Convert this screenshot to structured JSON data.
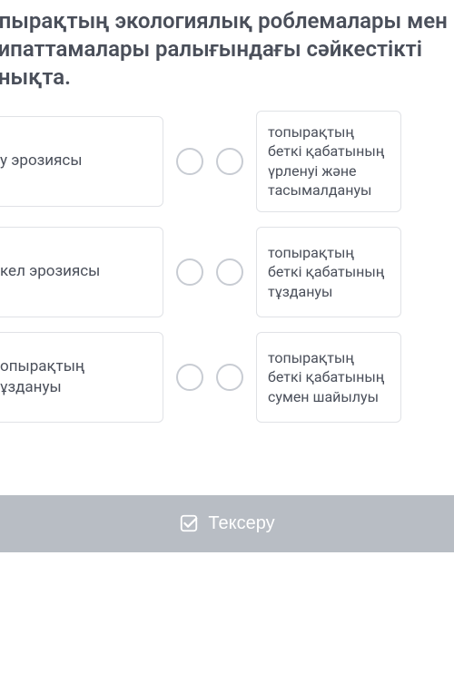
{
  "question": {
    "title": "опырақтың экологиялық роблемалары мен сипаттамалары ралығындағы сәйкестікті анықта."
  },
  "rows": [
    {
      "left": "у эрозиясы",
      "right": "топырақтың беткі қабатының үрленуі және тасымалдануы"
    },
    {
      "left": "кел эрозиясы",
      "right": "топырақтың беткі қабатының тұздануы"
    },
    {
      "left": "опырақтың ұздануы",
      "right": "топырақтың беткі қабатының сумен шайылуы"
    }
  ],
  "button": {
    "check_label": "Тексеру"
  }
}
